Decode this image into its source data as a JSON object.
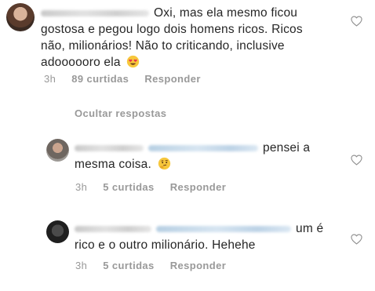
{
  "comments": [
    {
      "text_line1": "Oxi, mas ela mesmo ficou",
      "text_line2": "gostosa e pegou logo dois homens ricos. Ricos",
      "text_line3": "não, milionários! Não to criticando, inclusive",
      "text_line4": "adoooooro ela",
      "emoji_icon": "heart-eyes-emoji-icon",
      "time": "3h",
      "likes": "89 curtidas",
      "reply_label": "Responder"
    },
    {
      "text_line1": "pensei a",
      "text_line2": "mesma coisa.",
      "emoji_icon": "thinking-face-emoji-icon",
      "time": "3h",
      "likes": "5 curtidas",
      "reply_label": "Responder"
    },
    {
      "text_line1": "um é",
      "text_line2": "rico e o outro milionário.  Hehehe",
      "time": "3h",
      "likes": "5 curtidas",
      "reply_label": "Responder"
    }
  ],
  "hide_replies_label": "Ocultar respostas",
  "colors": {
    "text": "#262626",
    "muted": "#999999",
    "background": "#ffffff"
  }
}
